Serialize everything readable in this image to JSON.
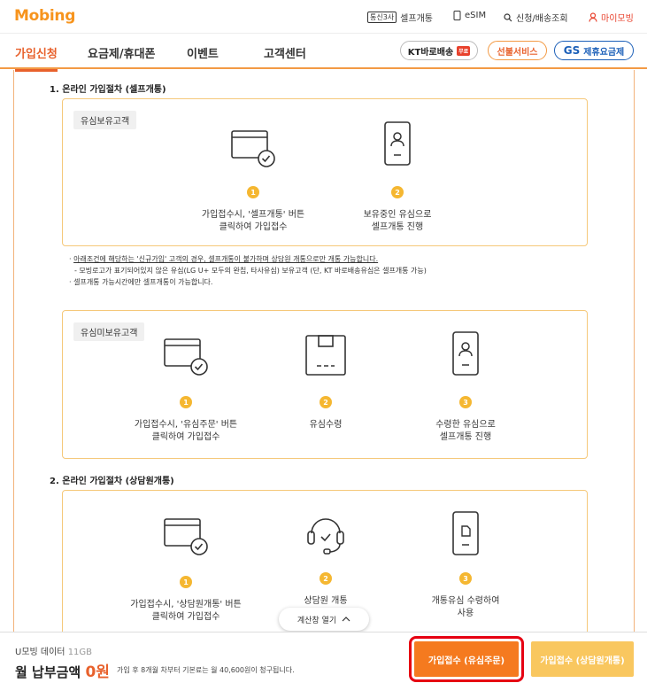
{
  "brand": {
    "logo": "Mobing"
  },
  "utility": {
    "telecom_badge": "통신3사",
    "self_activation": "셀프개통",
    "esim": "eSIM",
    "order_lookup": "신청/배송조회",
    "mypage": "마이모빙"
  },
  "nav": {
    "tabs": [
      {
        "label": "가입신청",
        "active": true
      },
      {
        "label": "요금제/휴대폰",
        "active": false
      },
      {
        "label": "이벤트",
        "active": false
      },
      {
        "label": "고객센터",
        "active": false
      }
    ],
    "kt_delivery": "KT바로배송",
    "kt_delivery_badge": "무료",
    "gift_service": "선불서비스",
    "gs_partner_brand": "GS",
    "gs_partner": "제휴요금제"
  },
  "section1": {
    "title": "1. 온라인 가입절차 (셀프개통)",
    "box1": {
      "label": "유심보유고객",
      "steps": [
        {
          "num": "1",
          "text": "가입접수시, '셀프개통' 버튼\n클릭하여 가입접수",
          "icon": "card-check-icon"
        },
        {
          "num": "2",
          "text": "보유중인 유심으로\n셀프개통 진행",
          "icon": "usim-card-icon"
        }
      ]
    },
    "notes": {
      "line1": "아래조건에 해당하는 '신규가입' 고객의 경우, 셀프개통이 불가하며 상담원 개통으로만 개통 가능합니다.",
      "line2": "- 모빙로고가 표기되어있지 않은 유심(LG U+ 모두의 완칩, 타사유심) 보유고객 (단, KT 바로배송유심은 셀프개통 가능)",
      "line3": "셀프개통 가능시간에만 셀프개통이 가능합니다."
    },
    "box2": {
      "label": "유심미보유고객",
      "steps": [
        {
          "num": "1",
          "text": "가입접수시, '유심주문' 버튼\n클릭하여 가입접수",
          "icon": "card-check-icon"
        },
        {
          "num": "2",
          "text": "유심수령",
          "icon": "package-box-icon"
        },
        {
          "num": "3",
          "text": "수령한 유심으로\n셀프개통 진행",
          "icon": "usim-card-icon"
        }
      ]
    }
  },
  "section2": {
    "title": "2. 온라인 가입절차 (상담원개통)",
    "box": {
      "steps": [
        {
          "num": "1",
          "text": "가입접수시, '상담원개통' 버튼\n클릭하여 가입접수",
          "icon": "card-check-icon"
        },
        {
          "num": "2",
          "text": "상담원 개통",
          "icon": "headset-icon"
        },
        {
          "num": "3",
          "text": "개통유심 수령하여\n사용",
          "icon": "sim-chip-icon"
        }
      ]
    }
  },
  "calc_toggle": "계산창 열기",
  "bottom": {
    "plan_name": "U모빙 데이터",
    "plan_data": "11GB",
    "monthly_label": "월 납부금액",
    "monthly_value": "0원",
    "note": "가입 후 8개월 차부터 기본료는 월 40,600원이 청구됩니다.",
    "btn_usim_order": "가입접수 (유심주문)",
    "btn_agent": "가입접수 (상담원개통)"
  },
  "colors": {
    "accent": "#e8612c",
    "orange_button": "#f57a1f",
    "yellow_button": "#f9c75f",
    "step_badge": "#f5b731",
    "box_border": "#f5c87a"
  }
}
